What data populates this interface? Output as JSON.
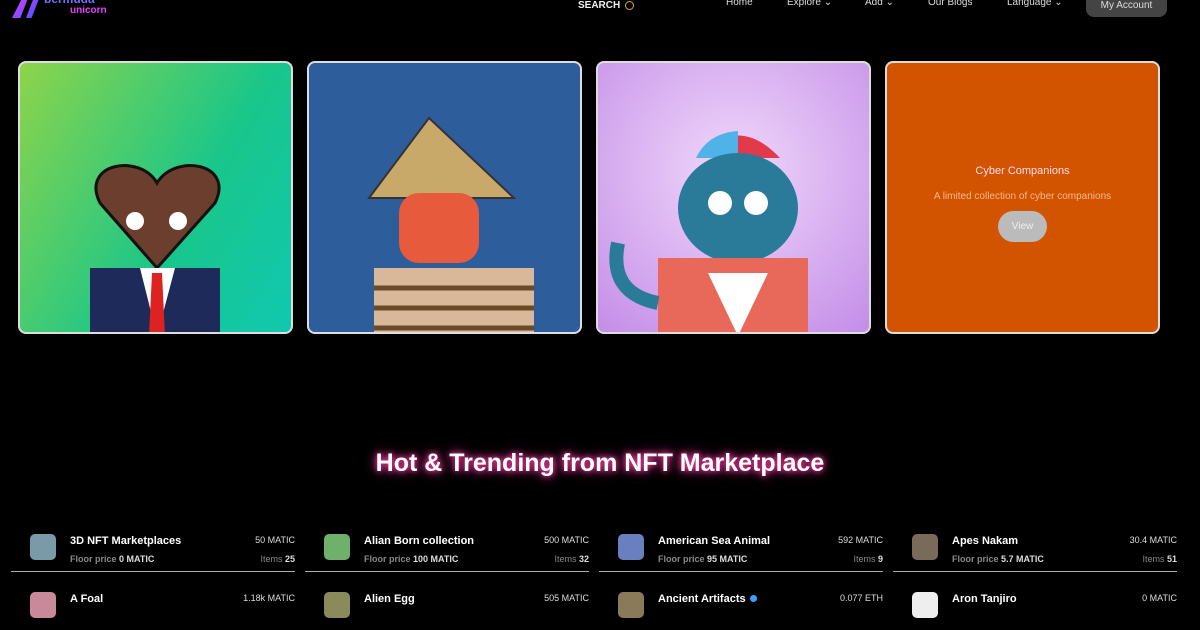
{
  "brand": {
    "line1": "bermuda",
    "line2": "unicorn"
  },
  "nav": {
    "search": "SEARCH",
    "home": "Home",
    "explore": "Explore",
    "add": "Add",
    "blogs": "Our Blogs",
    "language": "Language",
    "account": "My Account"
  },
  "featured": [
    {
      "title": "Cyber Companions",
      "description": "A limited collection of cyber companions",
      "button": "View"
    }
  ],
  "section_title": "Hot & Trending from NFT Marketplace",
  "labels": {
    "floor": "Floor price",
    "items": "Items"
  },
  "collections": [
    {
      "name": "3D NFT Marketplaces",
      "floor": "0 MATIC",
      "price": "50 MATIC",
      "items": "25",
      "color": "#7a9aa8"
    },
    {
      "name": "Alian Born collection",
      "floor": "100 MATIC",
      "price": "500 MATIC",
      "items": "32",
      "color": "#6fb06a"
    },
    {
      "name": "American Sea Animal",
      "floor": "95 MATIC",
      "price": "592 MATIC",
      "items": "9",
      "color": "#6a7fbf"
    },
    {
      "name": "Apes Nakam",
      "floor": "5.7 MATIC",
      "price": "30.4 MATIC",
      "items": "51",
      "color": "#7a6a5a"
    },
    {
      "name": "A Foal",
      "price": "1.18k MATIC",
      "color": "#c88a9a"
    },
    {
      "name": "Alien Egg",
      "price": "505 MATIC",
      "color": "#8a8a5a"
    },
    {
      "name": "Ancient Artifacts",
      "price": "0.077 ETH",
      "verified": true,
      "color": "#8a7a5a"
    },
    {
      "name": "Aron Tanjiro",
      "price": "0 MATIC",
      "color": "#eeeeee"
    }
  ]
}
